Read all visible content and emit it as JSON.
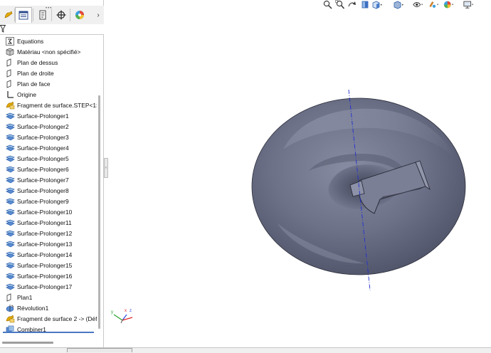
{
  "tree": {
    "items": [
      {
        "label": "Equations",
        "icon": "equations-icon"
      },
      {
        "label": "Matériau <non spécifié>",
        "icon": "material-icon"
      },
      {
        "label": "Plan de dessus",
        "icon": "plane-icon"
      },
      {
        "label": "Plan de droite",
        "icon": "plane-icon"
      },
      {
        "label": "Plan de face",
        "icon": "plane-icon"
      },
      {
        "label": "Origine",
        "icon": "origin-icon"
      },
      {
        "label": "Fragment de surface.STEP<1>",
        "icon": "imported-surface-icon"
      },
      {
        "label": "Surface-Prolonger1",
        "icon": "extend-surface-icon"
      },
      {
        "label": "Surface-Prolonger2",
        "icon": "extend-surface-icon"
      },
      {
        "label": "Surface-Prolonger3",
        "icon": "extend-surface-icon"
      },
      {
        "label": "Surface-Prolonger4",
        "icon": "extend-surface-icon"
      },
      {
        "label": "Surface-Prolonger5",
        "icon": "extend-surface-icon"
      },
      {
        "label": "Surface-Prolonger6",
        "icon": "extend-surface-icon"
      },
      {
        "label": "Surface-Prolonger7",
        "icon": "extend-surface-icon"
      },
      {
        "label": "Surface-Prolonger8",
        "icon": "extend-surface-icon"
      },
      {
        "label": "Surface-Prolonger9",
        "icon": "extend-surface-icon"
      },
      {
        "label": "Surface-Prolonger10",
        "icon": "extend-surface-icon"
      },
      {
        "label": "Surface-Prolonger11",
        "icon": "extend-surface-icon"
      },
      {
        "label": "Surface-Prolonger12",
        "icon": "extend-surface-icon"
      },
      {
        "label": "Surface-Prolonger13",
        "icon": "extend-surface-icon"
      },
      {
        "label": "Surface-Prolonger14",
        "icon": "extend-surface-icon"
      },
      {
        "label": "Surface-Prolonger15",
        "icon": "extend-surface-icon"
      },
      {
        "label": "Surface-Prolonger16",
        "icon": "extend-surface-icon"
      },
      {
        "label": "Surface-Prolonger17",
        "icon": "extend-surface-icon"
      },
      {
        "label": "Plan1",
        "icon": "plane-icon"
      },
      {
        "label": "Révolution1",
        "icon": "revolve-icon"
      },
      {
        "label": "Fragment de surface 2 -> (Défa",
        "icon": "imported-surface-icon"
      },
      {
        "label": "Combiner1",
        "icon": "combine-icon"
      }
    ]
  },
  "triad": {
    "x": "x",
    "y": "y",
    "z": "z"
  },
  "colors": {
    "model_body": "#6b7086",
    "axis_line": "#1f2fd0",
    "panel_bg": "#f0f0f0",
    "selection_blue": "#4a78c2"
  }
}
